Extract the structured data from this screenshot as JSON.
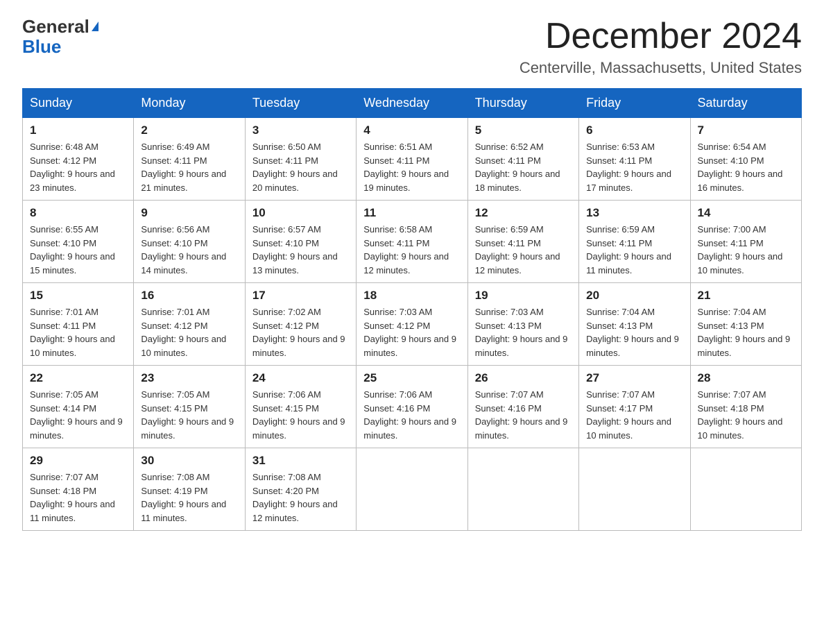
{
  "header": {
    "logo_general": "General",
    "logo_blue": "Blue",
    "month_title": "December 2024",
    "location": "Centerville, Massachusetts, United States"
  },
  "days_of_week": [
    "Sunday",
    "Monday",
    "Tuesday",
    "Wednesday",
    "Thursday",
    "Friday",
    "Saturday"
  ],
  "weeks": [
    [
      {
        "day": "1",
        "sunrise": "6:48 AM",
        "sunset": "4:12 PM",
        "daylight": "9 hours and 23 minutes."
      },
      {
        "day": "2",
        "sunrise": "6:49 AM",
        "sunset": "4:11 PM",
        "daylight": "9 hours and 21 minutes."
      },
      {
        "day": "3",
        "sunrise": "6:50 AM",
        "sunset": "4:11 PM",
        "daylight": "9 hours and 20 minutes."
      },
      {
        "day": "4",
        "sunrise": "6:51 AM",
        "sunset": "4:11 PM",
        "daylight": "9 hours and 19 minutes."
      },
      {
        "day": "5",
        "sunrise": "6:52 AM",
        "sunset": "4:11 PM",
        "daylight": "9 hours and 18 minutes."
      },
      {
        "day": "6",
        "sunrise": "6:53 AM",
        "sunset": "4:11 PM",
        "daylight": "9 hours and 17 minutes."
      },
      {
        "day": "7",
        "sunrise": "6:54 AM",
        "sunset": "4:10 PM",
        "daylight": "9 hours and 16 minutes."
      }
    ],
    [
      {
        "day": "8",
        "sunrise": "6:55 AM",
        "sunset": "4:10 PM",
        "daylight": "9 hours and 15 minutes."
      },
      {
        "day": "9",
        "sunrise": "6:56 AM",
        "sunset": "4:10 PM",
        "daylight": "9 hours and 14 minutes."
      },
      {
        "day": "10",
        "sunrise": "6:57 AM",
        "sunset": "4:10 PM",
        "daylight": "9 hours and 13 minutes."
      },
      {
        "day": "11",
        "sunrise": "6:58 AM",
        "sunset": "4:11 PM",
        "daylight": "9 hours and 12 minutes."
      },
      {
        "day": "12",
        "sunrise": "6:59 AM",
        "sunset": "4:11 PM",
        "daylight": "9 hours and 12 minutes."
      },
      {
        "day": "13",
        "sunrise": "6:59 AM",
        "sunset": "4:11 PM",
        "daylight": "9 hours and 11 minutes."
      },
      {
        "day": "14",
        "sunrise": "7:00 AM",
        "sunset": "4:11 PM",
        "daylight": "9 hours and 10 minutes."
      }
    ],
    [
      {
        "day": "15",
        "sunrise": "7:01 AM",
        "sunset": "4:11 PM",
        "daylight": "9 hours and 10 minutes."
      },
      {
        "day": "16",
        "sunrise": "7:01 AM",
        "sunset": "4:12 PM",
        "daylight": "9 hours and 10 minutes."
      },
      {
        "day": "17",
        "sunrise": "7:02 AM",
        "sunset": "4:12 PM",
        "daylight": "9 hours and 9 minutes."
      },
      {
        "day": "18",
        "sunrise": "7:03 AM",
        "sunset": "4:12 PM",
        "daylight": "9 hours and 9 minutes."
      },
      {
        "day": "19",
        "sunrise": "7:03 AM",
        "sunset": "4:13 PM",
        "daylight": "9 hours and 9 minutes."
      },
      {
        "day": "20",
        "sunrise": "7:04 AM",
        "sunset": "4:13 PM",
        "daylight": "9 hours and 9 minutes."
      },
      {
        "day": "21",
        "sunrise": "7:04 AM",
        "sunset": "4:13 PM",
        "daylight": "9 hours and 9 minutes."
      }
    ],
    [
      {
        "day": "22",
        "sunrise": "7:05 AM",
        "sunset": "4:14 PM",
        "daylight": "9 hours and 9 minutes."
      },
      {
        "day": "23",
        "sunrise": "7:05 AM",
        "sunset": "4:15 PM",
        "daylight": "9 hours and 9 minutes."
      },
      {
        "day": "24",
        "sunrise": "7:06 AM",
        "sunset": "4:15 PM",
        "daylight": "9 hours and 9 minutes."
      },
      {
        "day": "25",
        "sunrise": "7:06 AM",
        "sunset": "4:16 PM",
        "daylight": "9 hours and 9 minutes."
      },
      {
        "day": "26",
        "sunrise": "7:07 AM",
        "sunset": "4:16 PM",
        "daylight": "9 hours and 9 minutes."
      },
      {
        "day": "27",
        "sunrise": "7:07 AM",
        "sunset": "4:17 PM",
        "daylight": "9 hours and 10 minutes."
      },
      {
        "day": "28",
        "sunrise": "7:07 AM",
        "sunset": "4:18 PM",
        "daylight": "9 hours and 10 minutes."
      }
    ],
    [
      {
        "day": "29",
        "sunrise": "7:07 AM",
        "sunset": "4:18 PM",
        "daylight": "9 hours and 11 minutes."
      },
      {
        "day": "30",
        "sunrise": "7:08 AM",
        "sunset": "4:19 PM",
        "daylight": "9 hours and 11 minutes."
      },
      {
        "day": "31",
        "sunrise": "7:08 AM",
        "sunset": "4:20 PM",
        "daylight": "9 hours and 12 minutes."
      },
      null,
      null,
      null,
      null
    ]
  ]
}
